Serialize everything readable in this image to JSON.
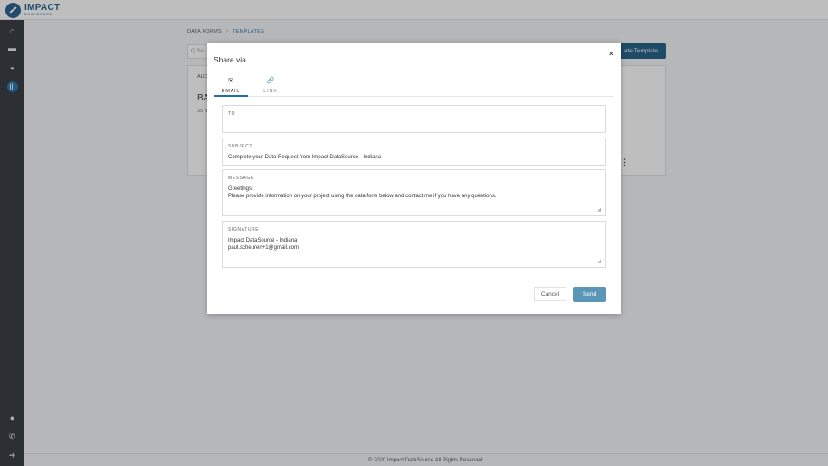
{
  "app": {
    "logo_title": "IMPACT",
    "logo_sub": "DASHBOARD"
  },
  "sidebar": {
    "items": [
      {
        "icon": "home-icon",
        "glyph": "⌂"
      },
      {
        "icon": "folder-icon",
        "glyph": "▬"
      },
      {
        "icon": "inbox-icon",
        "glyph": "◒"
      },
      {
        "icon": "columns-icon",
        "glyph": "|||"
      }
    ],
    "bottom_items": [
      {
        "icon": "user-icon",
        "glyph": "●"
      },
      {
        "icon": "phone-icon",
        "glyph": "✆"
      },
      {
        "icon": "sign-out-icon",
        "glyph": "➜"
      }
    ]
  },
  "breadcrumb": {
    "parent": "DATA FORMS",
    "separator": "›",
    "current": "TEMPLATES"
  },
  "search": {
    "placeholder": "Q  Se"
  },
  "toolbar": {
    "create_label": "ate Template"
  },
  "card": {
    "label": "AUC",
    "title": "BA",
    "meta": "35 N"
  },
  "footer": {
    "text": "© 2020 Impact DataSource All Rights Reserved."
  },
  "modal": {
    "title": "Share via",
    "close_glyph": "×",
    "tabs": [
      {
        "label": "EMAIL",
        "glyph": "✉",
        "active": true
      },
      {
        "label": "LINK",
        "glyph": "🔗",
        "active": false
      }
    ],
    "fields": {
      "to": {
        "label": "TO",
        "value": ""
      },
      "subject": {
        "label": "SUBJECT",
        "value": "Complete your Data Request from Impact DataSource - Indiana"
      },
      "message": {
        "label": "MESSAGE",
        "value": "Greetings!\nPlease provide information on your project using the data form below and contact me if you have any questions."
      },
      "signature": {
        "label": "SIGNATURE",
        "value": "Impact DataSource - Indiana\npaul.scheuren+1@gmail.com"
      }
    },
    "cancel_label": "Cancel",
    "send_label": "Send"
  },
  "colors": {
    "accent": "#1e6fa8",
    "primary_button": "#1b5b84",
    "send_button": "#5b96b7",
    "sidebar": "#2f3338"
  }
}
